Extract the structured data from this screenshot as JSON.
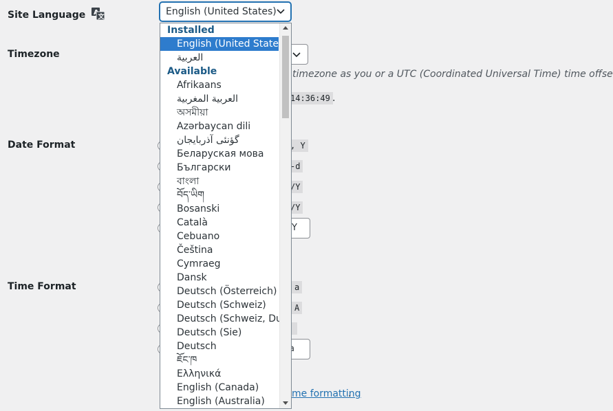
{
  "labels": {
    "site_language": "Site Language",
    "timezone": "Timezone",
    "date_format": "Date Format",
    "time_format": "Time Format"
  },
  "language_select": {
    "value": "English (United States)"
  },
  "background": {
    "timezone_help": "timezone as you or a UTC (Coordinated Universal Time) time offset.",
    "universal_time": "14:36:49",
    "universal_time_period": ".",
    "date_codes": [
      ", Y",
      "-d",
      "/Y",
      "/Y"
    ],
    "date_custom_value": "Y",
    "time_codes": [
      "a",
      "A",
      ""
    ],
    "time_custom_value": "a",
    "doc_link": "me formatting",
    "doc_link_period": "."
  },
  "dropdown": {
    "groups": {
      "installed": "Installed",
      "available": "Available"
    },
    "installed": [
      "English (United States)",
      "العربية"
    ],
    "selected": "English (United States)",
    "available": [
      "Afrikaans",
      "العربية المغربية",
      "অসমীয়া",
      "Azərbaycan dili",
      "گؤنئی آذربایجان",
      "Беларуская мова",
      "Български",
      "বাংলা",
      "བོད་ཡིག",
      "Bosanski",
      "Català",
      "Cebuano",
      "Čeština",
      "Cymraeg",
      "Dansk",
      "Deutsch (Österreich)",
      "Deutsch (Schweiz)",
      "Deutsch (Schweiz, Du)",
      "Deutsch (Sie)",
      "Deutsch",
      "ཇོང་ཁ",
      "Ελληνικά",
      "English (Canada)",
      "English (Australia)"
    ]
  },
  "colors": {
    "accent": "#2271b1",
    "selected_bg": "#2e7ccd",
    "group_text": "#1b5a86"
  },
  "icons": {
    "language": "translate-icon",
    "chevron": "chevron-down-icon"
  }
}
